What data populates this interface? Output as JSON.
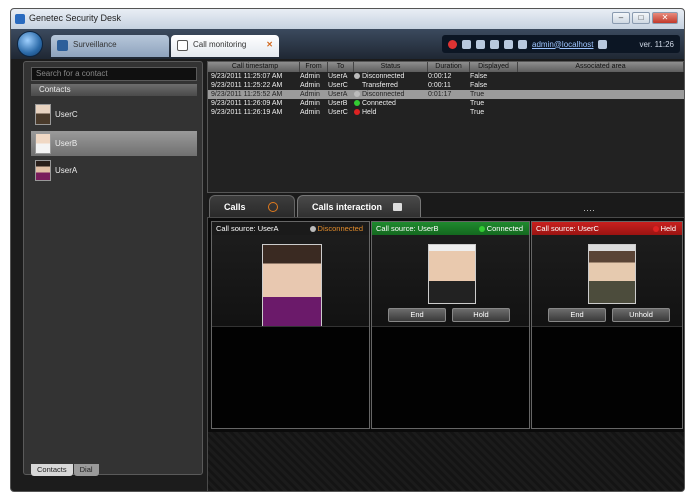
{
  "window": {
    "title": "Genetec Security Desk"
  },
  "tabs": [
    {
      "label": "Surveillance"
    },
    {
      "label": "Call monitoring",
      "close": "✕"
    }
  ],
  "tray": {
    "user": "admin@localhost",
    "version": "ver. 11:26"
  },
  "sidebar": {
    "search_placeholder": "Search for a contact",
    "contacts_header": "Contacts",
    "contacts": [
      {
        "name": "UserC",
        "selected": false
      },
      {
        "name": "UserB",
        "selected": true
      },
      {
        "name": "UserA",
        "selected": false
      }
    ],
    "bottom_tabs": [
      "Contacts",
      "Dial"
    ]
  },
  "call_log": {
    "columns": [
      "Call timestamp",
      "From",
      "To",
      "Status",
      "Duration",
      "Displayed",
      "Associated area"
    ],
    "rows": [
      {
        "timestamp": "9/23/2011 11:25:07 AM",
        "from": "Admin",
        "to": "UserA",
        "status": "Disconnected",
        "status_color": "grey",
        "duration": "0:00:12",
        "displayed": "False",
        "area": ""
      },
      {
        "timestamp": "9/23/2011 11:25:22 AM",
        "from": "Admin",
        "to": "UserC",
        "status": "Transferred",
        "status_color": "none",
        "duration": "0:00:11",
        "displayed": "False",
        "area": ""
      },
      {
        "timestamp": "9/23/2011 11:25:52 AM",
        "from": "Admin",
        "to": "UserA",
        "status": "Disconnected",
        "status_color": "grey",
        "duration": "0:01:17",
        "displayed": "True",
        "area": "",
        "selected": true
      },
      {
        "timestamp": "9/23/2011 11:26:09 AM",
        "from": "Admin",
        "to": "UserB",
        "status": "Connected",
        "status_color": "green",
        "duration": "",
        "displayed": "True",
        "area": ""
      },
      {
        "timestamp": "9/23/2011 11:26:19 AM",
        "from": "Admin",
        "to": "UserC",
        "status": "Held",
        "status_color": "red",
        "duration": "",
        "displayed": "True",
        "area": ""
      }
    ]
  },
  "panel_tabs": {
    "calls": "Calls",
    "interaction": "Calls interaction",
    "grip": "····"
  },
  "calls": [
    {
      "source_label": "Call source:",
      "source": "UserA",
      "state": "Disconnected",
      "buttons": []
    },
    {
      "source_label": "Call source:",
      "source": "UserB",
      "state": "Connected",
      "buttons": [
        "End",
        "Hold"
      ]
    },
    {
      "source_label": "Call source:",
      "source": "UserC",
      "state": "Held",
      "buttons": [
        "End",
        "Unhold"
      ]
    }
  ]
}
